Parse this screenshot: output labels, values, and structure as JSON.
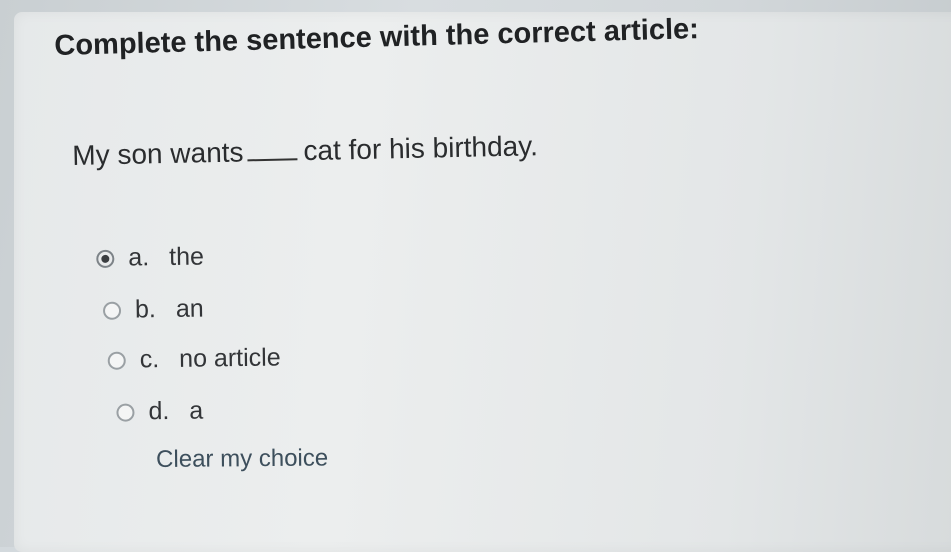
{
  "question": {
    "title": "Complete the sentence with the correct article:",
    "sentence_before": "My son wants",
    "sentence_after": "cat for his birthday."
  },
  "options": [
    {
      "letter": "a.",
      "text": "the",
      "selected": true
    },
    {
      "letter": "b.",
      "text": "an",
      "selected": false
    },
    {
      "letter": "c.",
      "text": "no article",
      "selected": false
    },
    {
      "letter": "d.",
      "text": "a",
      "selected": false
    }
  ],
  "clear_label": "Clear my choice"
}
